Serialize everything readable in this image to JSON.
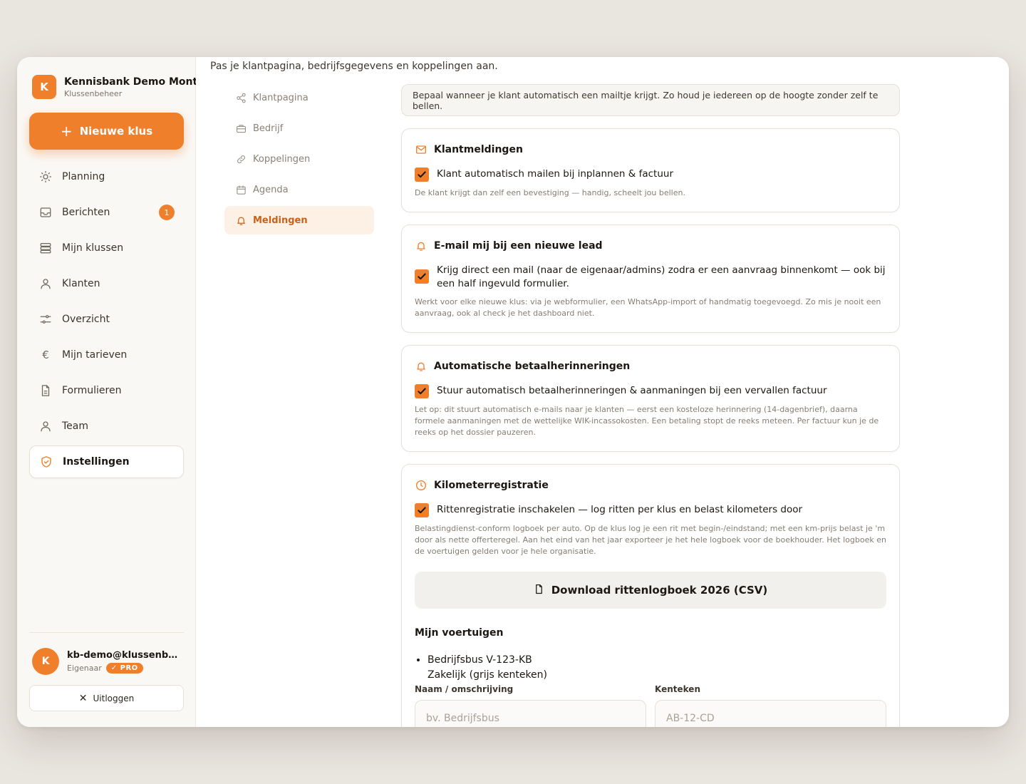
{
  "brand": {
    "initial": "K",
    "name": "Kennisbank Demo Montage",
    "subtitle": "Klussenbeheer"
  },
  "new_job_label": "Nieuwe klus",
  "nav": [
    {
      "label": "Planning",
      "icon": "sun-icon"
    },
    {
      "label": "Berichten",
      "icon": "inbox-icon",
      "badge": "1"
    },
    {
      "label": "Mijn klussen",
      "icon": "stack-icon"
    },
    {
      "label": "Klanten",
      "icon": "user-icon"
    },
    {
      "label": "Overzicht",
      "icon": "sliders-icon"
    },
    {
      "label": "Mijn tarieven",
      "icon": "euro-icon"
    },
    {
      "label": "Formulieren",
      "icon": "document-icon"
    },
    {
      "label": "Team",
      "icon": "user-icon"
    },
    {
      "label": "Instellingen",
      "icon": "shield-icon",
      "active": true
    }
  ],
  "user": {
    "initial": "K",
    "email": "kb-demo@klussenbeheer.nl",
    "role": "Eigenaar",
    "plan": "PRO"
  },
  "logout_label": "Uitloggen",
  "intro": "Pas je klantpagina, bedrijfsgegevens en koppelingen aan.",
  "subnav": [
    {
      "label": "Klantpagina",
      "icon": "share-icon"
    },
    {
      "label": "Bedrijf",
      "icon": "briefcase-icon"
    },
    {
      "label": "Koppelingen",
      "icon": "link-icon"
    },
    {
      "label": "Agenda",
      "icon": "calendar-icon"
    },
    {
      "label": "Meldingen",
      "icon": "bell-icon",
      "active": true
    }
  ],
  "notice": "Bepaal wanneer je klant automatisch een mailtje krijgt. Zo houd je iedereen op de hoogte zonder zelf te bellen.",
  "cards": {
    "klant": {
      "title": "Klantmeldingen",
      "check": "Klant automatisch mailen bij inplannen & factuur",
      "help": "De klant krijgt dan zelf een bevestiging — handig, scheelt jou bellen."
    },
    "lead": {
      "title": "E-mail mij bij een nieuwe lead",
      "check": "Krijg direct een mail (naar de eigenaar/admins) zodra er een aanvraag binnenkomt — ook bij een half ingevuld formulier.",
      "help": "Werkt voor elke nieuwe klus: via je webformulier, een WhatsApp-import of handmatig toegevoegd. Zo mis je nooit een aanvraag, ook al check je het dashboard niet."
    },
    "betaal": {
      "title": "Automatische betaalherinneringen",
      "check": "Stuur automatisch betaalherinneringen & aanmaningen bij een vervallen factuur",
      "help": "Let op: dit stuurt automatisch e-mails naar je klanten — eerst een kosteloze herinnering (14-dagenbrief), daarna formele aanmaningen met de wettelijke WIK-incassokosten. Een betaling stopt de reeks meteen. Per factuur kun je de reeks op het dossier pauzeren."
    },
    "km": {
      "title": "Kilometerregistratie",
      "check": "Rittenregistratie inschakelen — log ritten per klus en belast kilometers door",
      "help": "Belastingdienst-conform logboek per auto. Op de klus log je een rit met begin-/eindstand; met een km-prijs belast je 'm door als nette offerteregel. Aan het eind van het jaar exporteer je het hele logboek voor de boekhouder. Het logboek en de voertuigen gelden voor je hele organisatie.",
      "download": "Download rittenlogboek 2026 (CSV)",
      "vehicles_title": "Mijn voertuigen",
      "vehicle": {
        "name": "Bedrijfsbus V-123-KB",
        "type": "Zakelijk (grijs kenteken)"
      },
      "form": {
        "name_label": "Naam / omschrijving",
        "name_placeholder": "bv. Bedrijfsbus",
        "plate_label": "Kenteken",
        "plate_placeholder": "AB-12-CD"
      }
    }
  },
  "colors": {
    "accent": "#f07f2b",
    "accent_text": "#c7621b"
  }
}
